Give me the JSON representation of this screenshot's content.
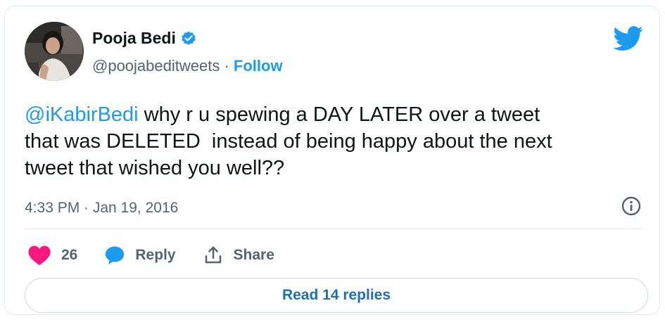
{
  "author": {
    "display_name": "Pooja Bedi",
    "handle": "@poojabeditweets",
    "separator": " · ",
    "follow_label": "Follow",
    "verified": true
  },
  "tweet": {
    "mention": "@iKabirBedi",
    "text": " why r u spewing a DAY LATER over a tweet\nthat was DELETED  instead of being happy about the next\ntweet that wished you well??",
    "timestamp": "4:33 PM · Jan 19, 2016"
  },
  "actions": {
    "like_count": "26",
    "reply_label": "Reply",
    "share_label": "Share"
  },
  "footer": {
    "read_replies_label": "Read 14 replies"
  },
  "colors": {
    "accent": "#1d9bf0",
    "heart": "#f91880",
    "muted": "#536471",
    "text": "#0f1419"
  },
  "icons": {
    "verified": "verified-badge-icon",
    "logo": "twitter-bird-icon",
    "info": "info-icon",
    "like": "heart-icon",
    "reply": "speech-bubble-icon",
    "share": "share-upload-icon"
  }
}
